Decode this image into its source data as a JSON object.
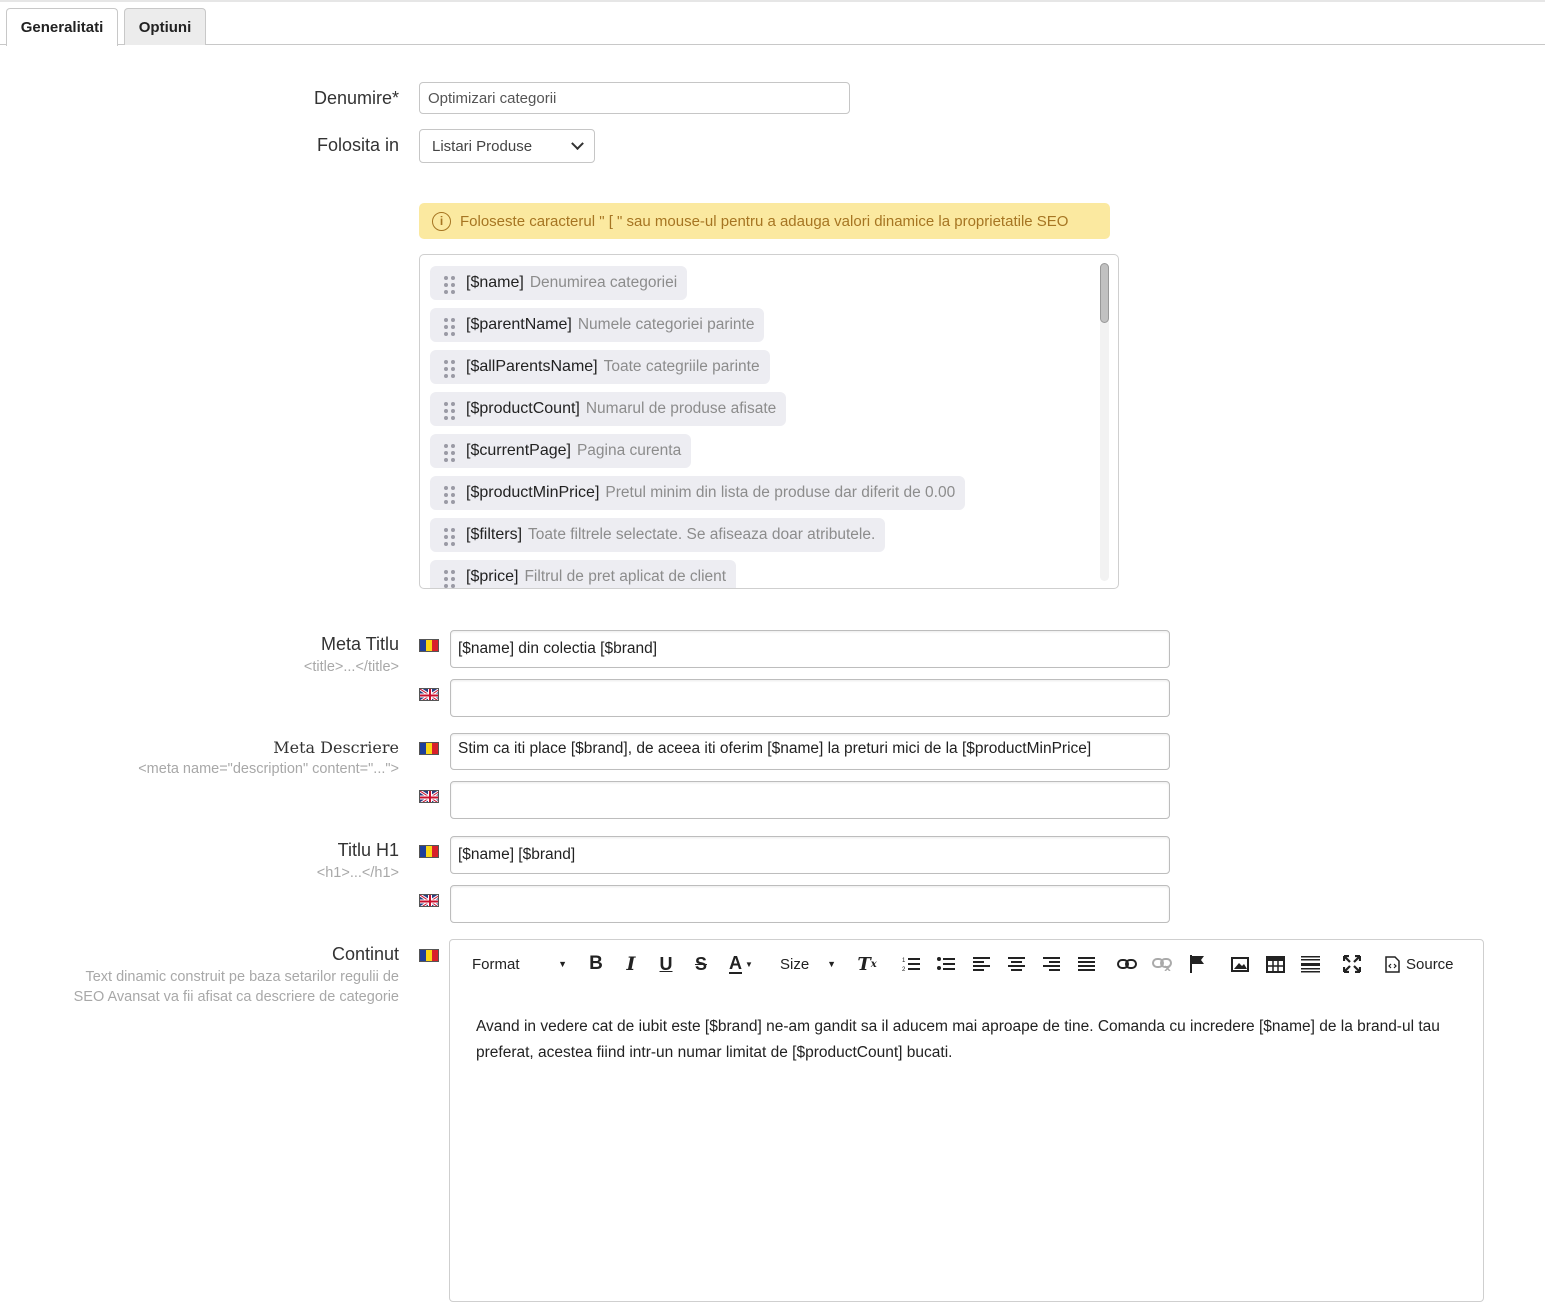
{
  "tabs": [
    {
      "label": "Generalitati",
      "active": true
    },
    {
      "label": "Optiuni",
      "active": false
    }
  ],
  "form": {
    "name_label": "Denumire*",
    "name_value": "Optimizari categorii",
    "used_in_label": "Folosita in",
    "used_in_value": "Listari Produse",
    "alert": "Foloseste caracterul \" [ \" sau mouse-ul pentru a adauga valori dinamice la proprietatile SEO",
    "variables": [
      {
        "var": "[$name]",
        "desc": "Denumirea categoriei"
      },
      {
        "var": "[$parentName]",
        "desc": "Numele categoriei parinte"
      },
      {
        "var": "[$allParentsName]",
        "desc": "Toate categriile parinte"
      },
      {
        "var": "[$productCount]",
        "desc": "Numarul de produse afisate"
      },
      {
        "var": "[$currentPage]",
        "desc": "Pagina curenta"
      },
      {
        "var": "[$productMinPrice]",
        "desc": "Pretul minim din lista de produse dar diferit de 0.00"
      },
      {
        "var": "[$filters]",
        "desc": "Toate filtrele selectate. Se afiseaza doar atributele."
      },
      {
        "var": "[$price]",
        "desc": "Filtrul de pret aplicat de client"
      }
    ],
    "meta_title": {
      "label": "Meta Titlu",
      "hint": "<title>...</title>",
      "ro": "[$name] din colectia [$brand]",
      "en": ""
    },
    "meta_description": {
      "label": "Meta Descriere",
      "hint": "<meta name=\"description\" content=\"...\">",
      "ro": "Stim ca iti place [$brand], de aceea iti oferim [$name] la preturi mici de la [$productMinPrice]",
      "en": ""
    },
    "h1": {
      "label": "Titlu H1",
      "hint": "<h1>...</h1>",
      "ro": "[$name] [$brand]",
      "en": ""
    },
    "content": {
      "label": "Continut",
      "hint_line1": "Text dinamic construit pe baza setarilor regulii de",
      "hint_line2": "SEO Avansat va fii afisat ca descriere de categorie",
      "text": "Avand in vedere cat de iubit este [$brand] ne-am gandit sa il aducem mai aproape de tine. Comanda cu incredere [$name] de la brand-ul tau preferat, acestea fiind intr-un numar limitat de [$productCount] bucati."
    }
  },
  "toolbar": {
    "format": "Format",
    "size": "Size",
    "source": "Source"
  },
  "colors": {
    "alert_bg": "#fbe9a0",
    "alert_text": "#a67522",
    "chip_bg": "#ededf2"
  }
}
